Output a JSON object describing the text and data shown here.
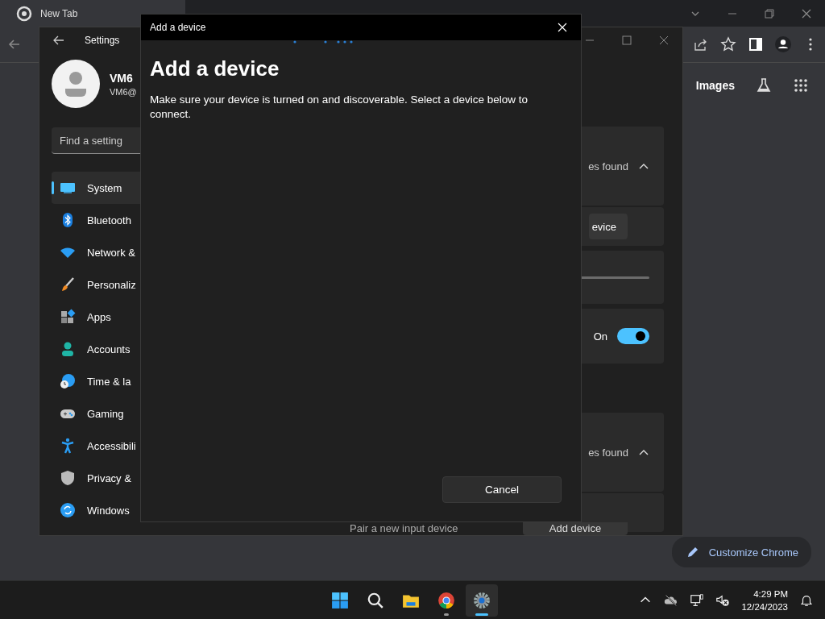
{
  "browser": {
    "tab_title": "New Tab",
    "links": [
      "Images"
    ],
    "customize_button": "Customize Chrome"
  },
  "settings_window": {
    "title": "Settings",
    "profile": {
      "name": "VM6",
      "email": "VM6@"
    },
    "search": {
      "placeholder": "Find a setting"
    },
    "nav_items": [
      {
        "label": "System",
        "selected": true
      },
      {
        "label": "Bluetooth",
        "selected": false
      },
      {
        "label": "Network &",
        "selected": false
      },
      {
        "label": "Personaliz",
        "selected": false
      },
      {
        "label": "Apps",
        "selected": false
      },
      {
        "label": "Accounts",
        "selected": false
      },
      {
        "label": "Time & la",
        "selected": false
      },
      {
        "label": "Gaming",
        "selected": false
      },
      {
        "label": "Accessibili",
        "selected": false
      },
      {
        "label": "Privacy &",
        "selected": false
      },
      {
        "label": "Windows",
        "selected": false
      }
    ],
    "panes": [
      {
        "kind": "expander",
        "text": "es found",
        "expanded": true
      },
      {
        "kind": "button",
        "text": "evice"
      },
      {
        "kind": "slider"
      },
      {
        "kind": "toggle",
        "text": "On",
        "on": true
      },
      {
        "kind": "expander",
        "text": "es found",
        "expanded": true
      },
      {
        "kind": "button_row",
        "label": "Pair a new input device",
        "text": "Add device"
      }
    ]
  },
  "dialog": {
    "title": "Add a device",
    "heading": "Add a device",
    "description": "Make sure your device is turned on and discoverable. Select a device below to connect.",
    "buttons": [
      "Cancel"
    ]
  },
  "taskbar": {
    "apps": [
      {
        "active": false,
        "running": false
      },
      {
        "active": false,
        "running": false
      },
      {
        "active": false,
        "running": false
      },
      {
        "active": false,
        "running": true
      },
      {
        "active": true,
        "running": true
      }
    ],
    "time": "4:29 PM",
    "date": "12/24/2023"
  }
}
